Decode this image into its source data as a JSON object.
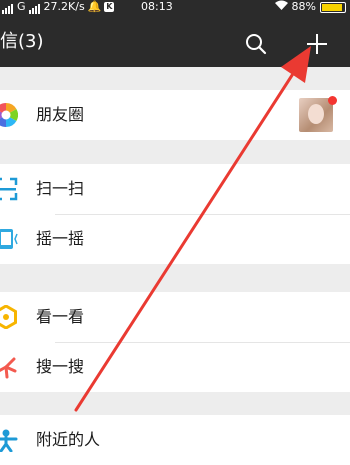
{
  "status_bar": {
    "carrier": "G",
    "speed": "27.2K/s",
    "time": "08:13",
    "battery": "88%",
    "battery_level": 0.88
  },
  "header": {
    "title": "信(3)"
  },
  "groups": [
    {
      "items": [
        {
          "label": "朋友圈",
          "icon": "moments-icon",
          "has_new_dot": true
        }
      ]
    },
    {
      "items": [
        {
          "label": "扫一扫",
          "icon": "scan-icon"
        },
        {
          "label": "摇一摇",
          "icon": "shake-icon"
        }
      ]
    },
    {
      "items": [
        {
          "label": "看一看",
          "icon": "top-stories-icon"
        },
        {
          "label": "搜一搜",
          "icon": "search-feature-icon"
        }
      ]
    },
    {
      "items": [
        {
          "label": "附近的人",
          "icon": "people-nearby-icon"
        }
      ]
    }
  ],
  "colors": {
    "header_bg": "#2b2b2b",
    "page_bg": "#ededed",
    "annotation_arrow": "#ea3a32",
    "badge_red": "#f43530"
  }
}
